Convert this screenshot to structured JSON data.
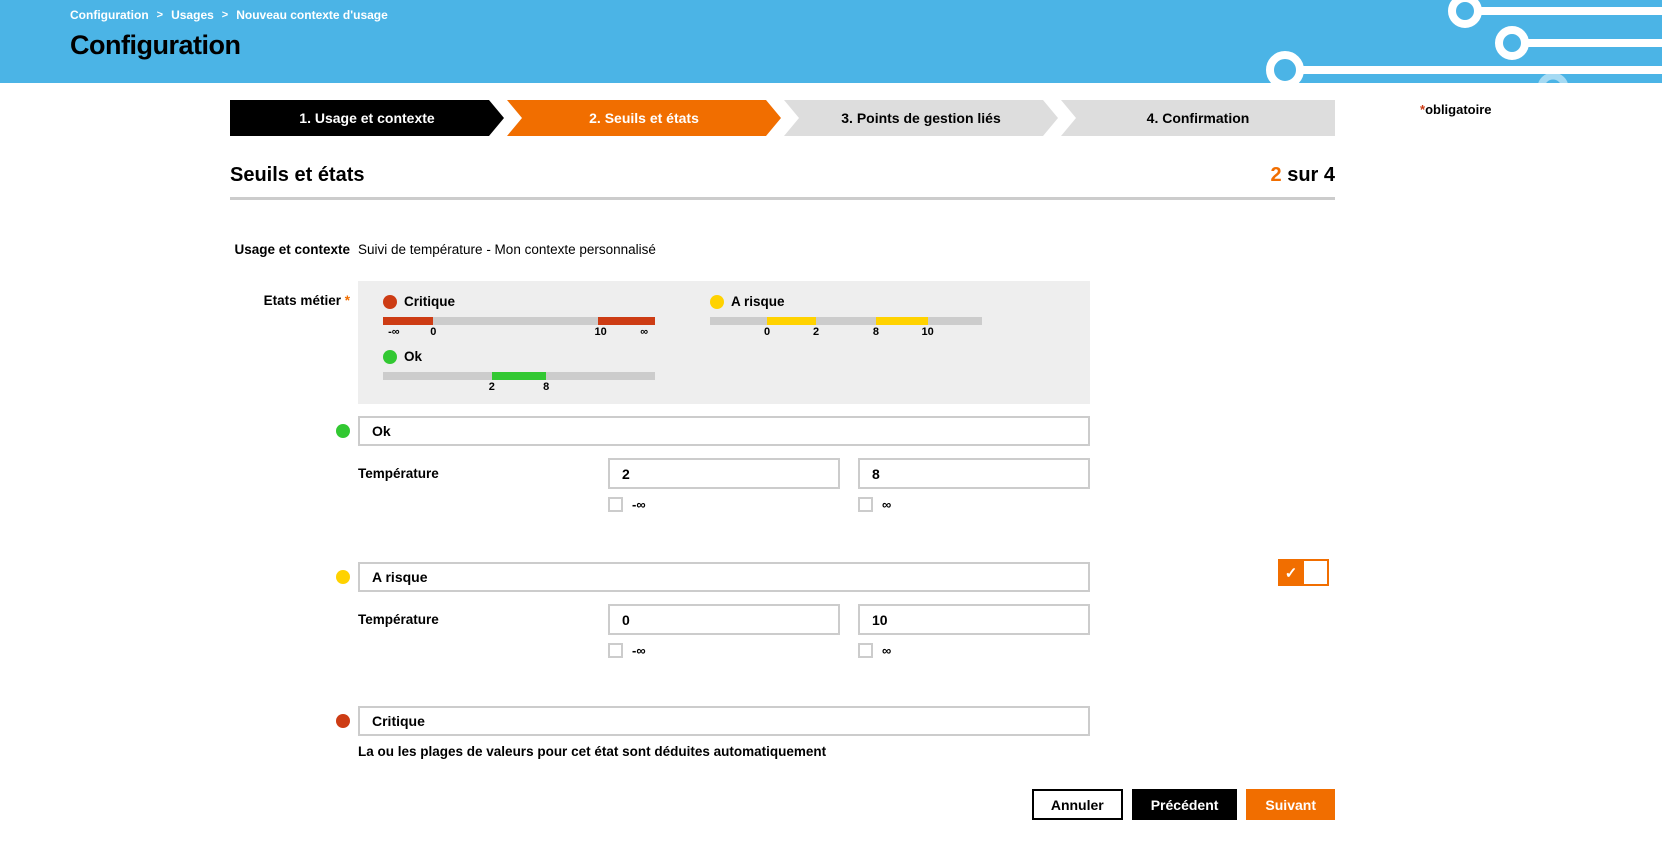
{
  "header": {
    "breadcrumb": [
      {
        "label": "Configuration"
      },
      {
        "label": "Usages"
      },
      {
        "label": "Nouveau contexte d'usage"
      }
    ],
    "separator": ">",
    "title": "Configuration"
  },
  "required_note": {
    "asterisk": "*",
    "label": "obligatoire"
  },
  "colors": {
    "header_blue": "#4bb4e6",
    "accent_orange": "#f16e00",
    "critical_red": "#cd3c14",
    "warning_yellow": "#ffd200",
    "ok_green": "#32c832"
  },
  "stepper": {
    "steps": [
      {
        "label": "1. Usage et contexte",
        "state": "done"
      },
      {
        "label": "2. Seuils et états",
        "state": "active"
      },
      {
        "label": "3. Points de gestion liés",
        "state": "upcoming"
      },
      {
        "label": "4. Confirmation",
        "state": "upcoming"
      }
    ]
  },
  "section": {
    "title": "Seuils et états",
    "progress_current": "2",
    "progress_suffix": " sur 4"
  },
  "context_row": {
    "label": "Usage et contexte",
    "value": "Suivi de température - Mon contexte personnalisé"
  },
  "states_preview": {
    "label": "Etats métier",
    "required_mark": "*",
    "items": [
      {
        "name": "Critique",
        "color": "#cd3c14",
        "segments": [
          {
            "from": 0,
            "to": 18.5,
            "color": "#cd3c14"
          },
          {
            "from": 18.5,
            "to": 79,
            "color": "#cccccc"
          },
          {
            "from": 79,
            "to": 100,
            "color": "#cd3c14"
          }
        ],
        "ticks": [
          {
            "pos": 4,
            "label": "-∞"
          },
          {
            "pos": 18.5,
            "label": "0"
          },
          {
            "pos": 80,
            "label": "10"
          },
          {
            "pos": 96,
            "label": "∞"
          }
        ]
      },
      {
        "name": "A risque",
        "color": "#ffd200",
        "segments": [
          {
            "from": 0,
            "to": 21,
            "color": "#cccccc"
          },
          {
            "from": 21,
            "to": 39,
            "color": "#ffd200"
          },
          {
            "from": 39,
            "to": 61,
            "color": "#cccccc"
          },
          {
            "from": 61,
            "to": 80,
            "color": "#ffd200"
          },
          {
            "from": 80,
            "to": 100,
            "color": "#cccccc"
          }
        ],
        "ticks": [
          {
            "pos": 21,
            "label": "0"
          },
          {
            "pos": 39,
            "label": "2"
          },
          {
            "pos": 61,
            "label": "8"
          },
          {
            "pos": 80,
            "label": "10"
          }
        ]
      },
      {
        "name": "Ok",
        "color": "#32c832",
        "segments": [
          {
            "from": 0,
            "to": 40,
            "color": "#cccccc"
          },
          {
            "from": 40,
            "to": 60,
            "color": "#32c832"
          },
          {
            "from": 60,
            "to": 100,
            "color": "#cccccc"
          }
        ],
        "ticks": [
          {
            "pos": 40,
            "label": "2"
          },
          {
            "pos": 60,
            "label": "8"
          }
        ]
      }
    ]
  },
  "state_forms": [
    {
      "name_value": "Ok",
      "dot_color": "#32c832",
      "temp_label": "Température",
      "min_value": "2",
      "max_value": "8",
      "neg_inf_label": "-∞",
      "pos_inf_label": "∞"
    },
    {
      "name_value": "A risque",
      "dot_color": "#ffd200",
      "temp_label": "Température",
      "min_value": "0",
      "max_value": "10",
      "neg_inf_label": "-∞",
      "pos_inf_label": "∞",
      "toggle_check": "✓"
    },
    {
      "name_value": "Critique",
      "dot_color": "#cd3c14",
      "note": "La ou les plages de valeurs pour cet état sont déduites automatiquement"
    }
  ],
  "actions": {
    "cancel": "Annuler",
    "previous": "Précédent",
    "next": "Suivant"
  }
}
